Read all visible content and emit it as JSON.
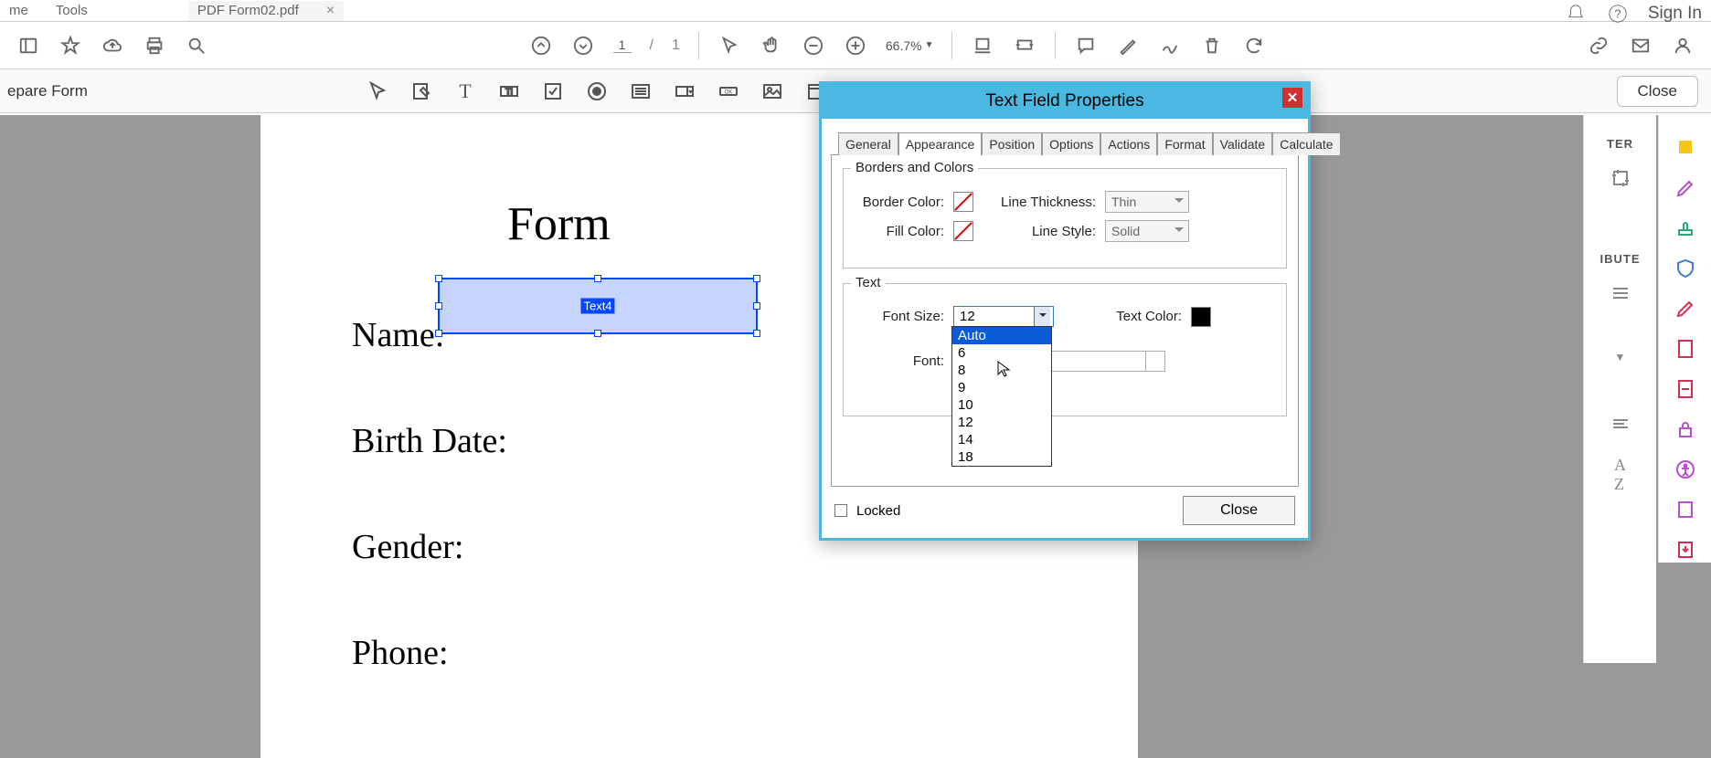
{
  "menu": {
    "item1": "me",
    "item2": "Tools",
    "tab": "PDF Form02.pdf",
    "signin": "Sign In"
  },
  "toolbar": {
    "page": "1",
    "sep": "/",
    "total": "1",
    "zoom": "66.7%"
  },
  "formbar": {
    "label": "epare Form",
    "close": "Close"
  },
  "doc": {
    "heading": "Form",
    "r1": "Name:",
    "r2": "Birth Date:",
    "r3": "Gender:",
    "r4": "Phone:",
    "fieldname": "Text4"
  },
  "side": {
    "h1": "TER",
    "h2": "IBUTE"
  },
  "dialog": {
    "title": "Text Field Properties",
    "tabs": [
      "General",
      "Appearance",
      "Position",
      "Options",
      "Actions",
      "Format",
      "Validate",
      "Calculate"
    ],
    "g1": "Borders and Colors",
    "g2": "Text",
    "bcolor": "Border Color:",
    "fcolor": "Fill Color:",
    "lthick": "Line Thickness:",
    "lthick_v": "Thin",
    "lstyle": "Line Style:",
    "lstyle_v": "Solid",
    "fsize": "Font Size:",
    "fsize_v": "12",
    "tcolor": "Text Color:",
    "font": "Font:",
    "sizes": [
      "Auto",
      "6",
      "8",
      "9",
      "10",
      "12",
      "14",
      "18"
    ],
    "locked": "Locked",
    "close": "Close"
  }
}
